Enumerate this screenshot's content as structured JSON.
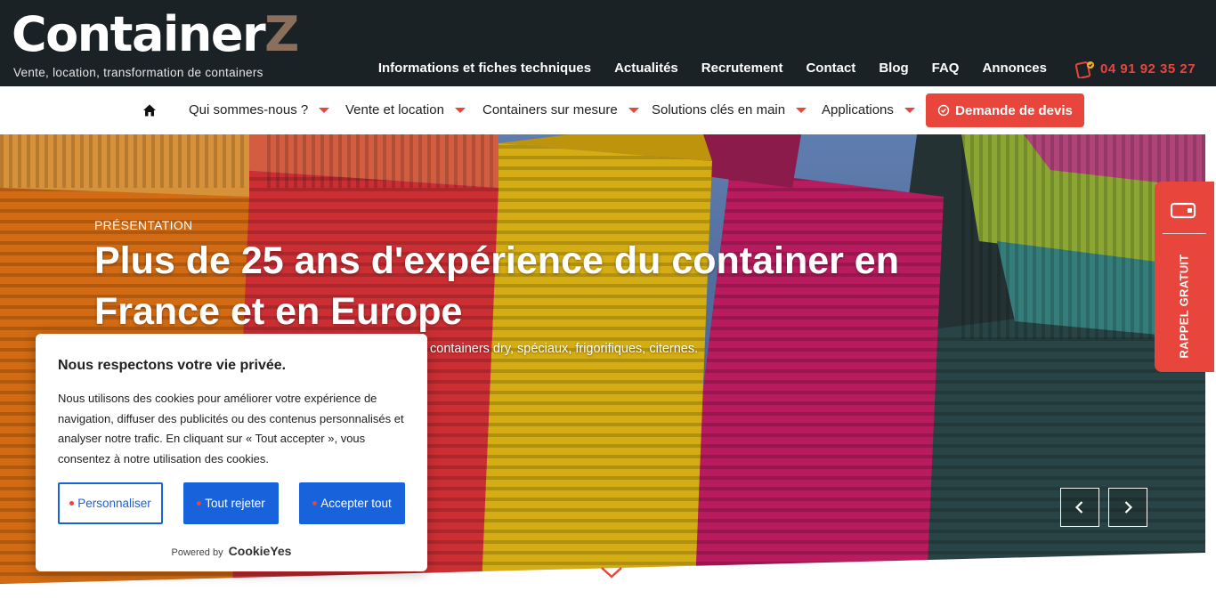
{
  "brand": {
    "name_main": "Container",
    "name_accent": "Z",
    "tagline": "Vente, location, transformation de containers"
  },
  "topnav": [
    "Informations et fiches techniques",
    "Actualités",
    "Recrutement",
    "Contact",
    "Blog",
    "FAQ",
    "Annonces"
  ],
  "phone": {
    "number": "04 91 92 35 27",
    "icon": "phone-icon"
  },
  "mainnav": {
    "home_icon": "home-icon",
    "items": [
      "Qui sommes-nous ?",
      "Vente et location",
      "Containers sur mesure",
      "Solutions clés en main",
      "Applications"
    ],
    "cta": "Demande de devis"
  },
  "hero": {
    "eyebrow": "PRÉSENTATION",
    "headline": "Plus de 25 ans d'expérience du container en France et en Europe",
    "subtext": "containers dry, spéciaux, frigorifiques, citernes."
  },
  "callback": {
    "label": "RAPPEL GRATUIT"
  },
  "cookie": {
    "title": "Nous respectons votre vie privée.",
    "body": "Nous utilisons des cookies pour améliorer votre expérience de navigation, diffuser des publicités ou des contenus personnalisés et analyser notre trafic. En cliquant sur « Tout accepter », vous consentez à notre utilisation des cookies.",
    "buttons": {
      "customize": "Personnaliser",
      "reject": "Tout rejeter",
      "accept": "Accepter tout"
    },
    "powered_by": "Powered by",
    "powered_brand": "CookieYes"
  },
  "colors": {
    "accent": "#e8453c",
    "topbar": "#1b2226",
    "cookie_blue": "#1863dc",
    "logo_accent": "#8a6f5c"
  }
}
